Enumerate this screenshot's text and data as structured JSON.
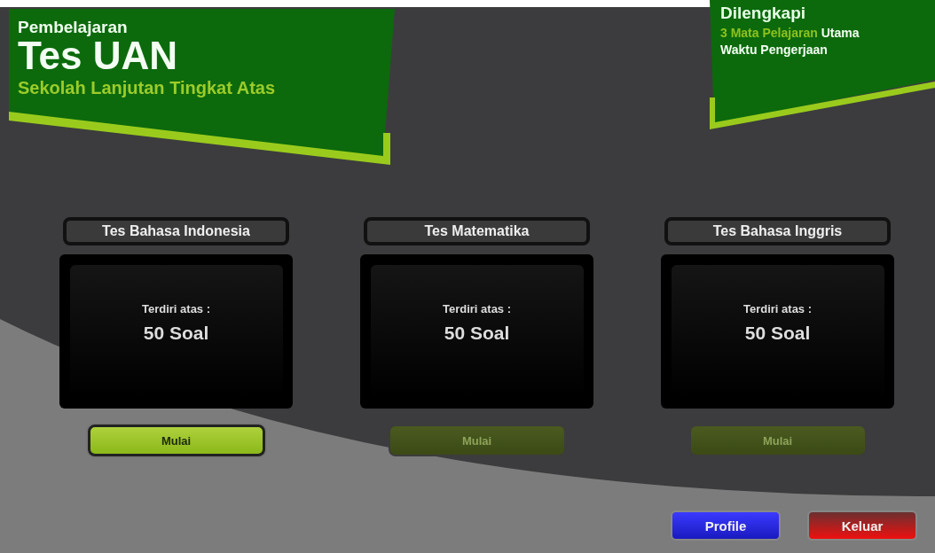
{
  "header": {
    "subtitle": "Pembelajaran",
    "title": "Tes UAN",
    "tagline": "Sekolah Lanjutan Tingkat Atas"
  },
  "info": {
    "title": "Dilengkapi",
    "line1_highlight": "3 Mata Pelajaran",
    "line1_rest": "Utama",
    "line2": "Waktu Pengerjaan"
  },
  "tests": [
    {
      "title": "Tes Bahasa Indonesia",
      "label": "Terdiri atas :",
      "count": "50 Soal",
      "button": "Mulai",
      "disabled": false
    },
    {
      "title": "Tes Matematika",
      "label": "Terdiri atas :",
      "count": "50 Soal",
      "button": "Mulai",
      "disabled": true
    },
    {
      "title": "Tes Bahasa Inggris",
      "label": "Terdiri atas :",
      "count": "50 Soal",
      "button": "Mulai",
      "disabled": true
    }
  ],
  "buttons": [
    {
      "label": "Profile",
      "kind": "primary"
    },
    {
      "label": "Keluar",
      "kind": "danger"
    }
  ]
}
